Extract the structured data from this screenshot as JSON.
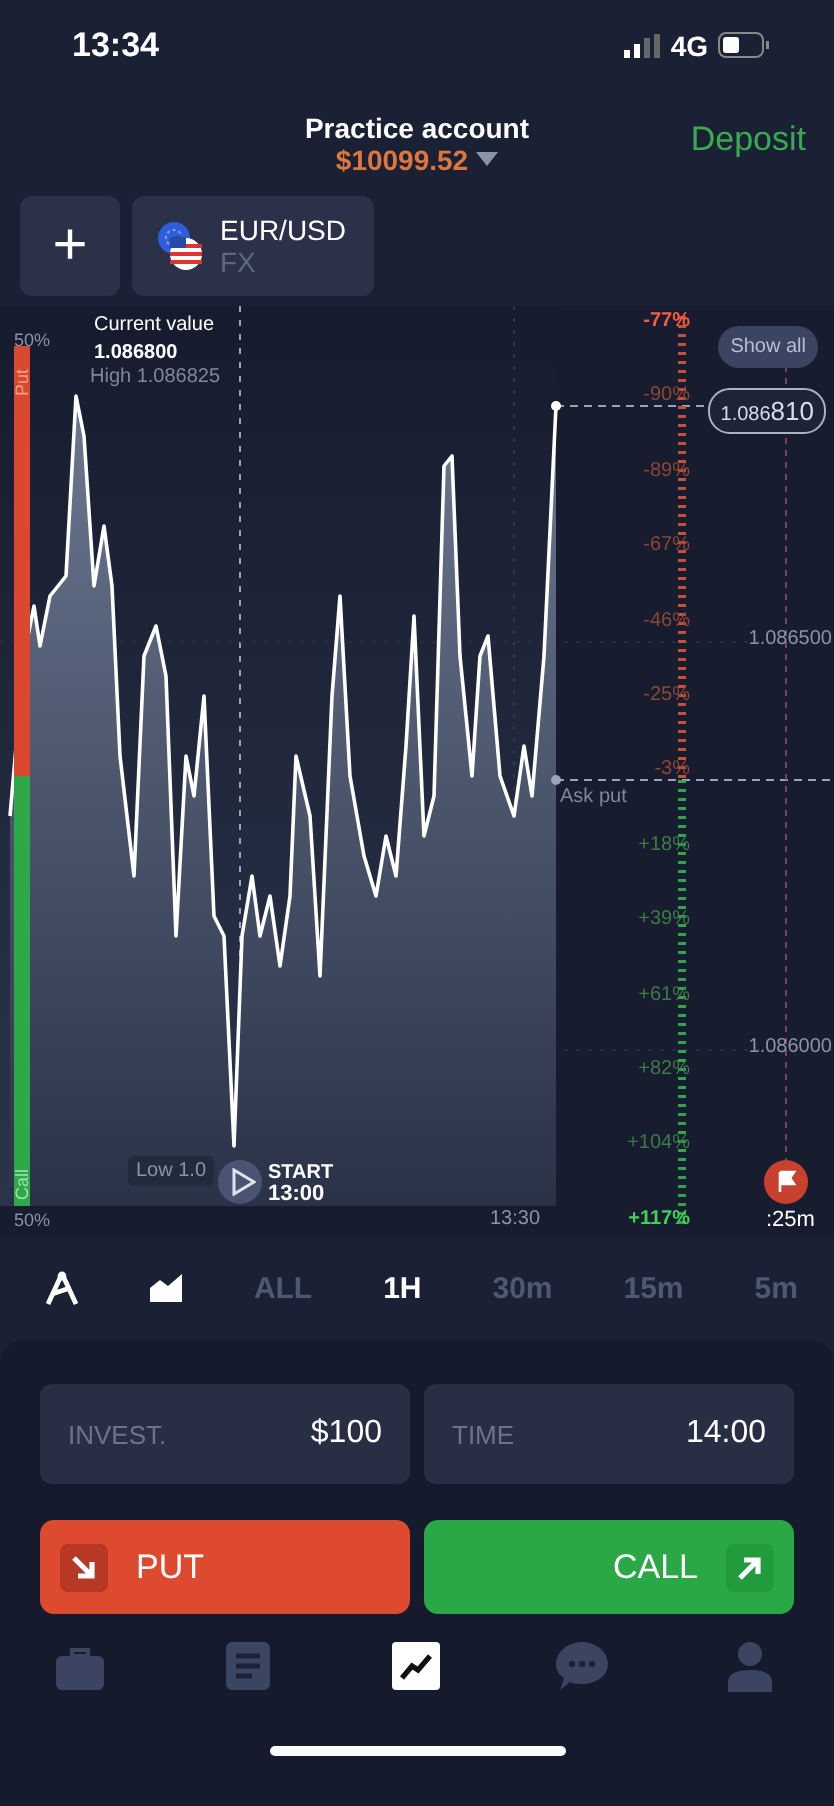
{
  "status_bar": {
    "time": "13:34",
    "network": "4G"
  },
  "header": {
    "account": "Practice account",
    "balance": "$10099.52",
    "deposit": "Deposit"
  },
  "asset": {
    "add": "+",
    "name": "EUR/USD",
    "type": "FX"
  },
  "chart": {
    "current_label": "Current value",
    "current_value": "1.086800",
    "high": "High 1.086825",
    "low": "Low 1.0",
    "show_all": "Show all",
    "price_badge_main": "1.086",
    "price_badge_tail": "810",
    "ask_label": "Ask put",
    "start_label": "START",
    "start_time": "13:00",
    "expiry": ":25m",
    "sentiment": {
      "top_percent": "50%",
      "bottom_percent": "50%",
      "put_label": "Put",
      "call_label": "Call",
      "level": 0.5
    },
    "time_label": "13:30",
    "ladder": [
      {
        "text": "-77%",
        "color": "#ff5a3c",
        "highlighted": true
      },
      {
        "text": "-90%",
        "color": "#8e4536",
        "highlighted": false
      },
      {
        "text": "-89%",
        "color": "#8e4536",
        "highlighted": false
      },
      {
        "text": "-67%",
        "color": "#8e4536",
        "highlighted": false
      },
      {
        "text": "-46%",
        "color": "#8e4536",
        "highlighted": false
      },
      {
        "text": "-25%",
        "color": "#8e4536",
        "highlighted": false
      },
      {
        "text": "-3%",
        "color": "#8e4536",
        "highlighted": false
      },
      {
        "text": "+18%",
        "color": "#3b7b46",
        "highlighted": false
      },
      {
        "text": "+39%",
        "color": "#3b7b46",
        "highlighted": false
      },
      {
        "text": "+61%",
        "color": "#3b7b46",
        "highlighted": false
      },
      {
        "text": "+82%",
        "color": "#3b7b46",
        "highlighted": false
      },
      {
        "text": "+104%",
        "color": "#3b7b46",
        "highlighted": false
      },
      {
        "text": "+117%",
        "color": "#3fd35c",
        "highlighted": true
      }
    ],
    "price_labels": [
      "1.086500",
      "1.086000"
    ]
  },
  "timeframes": [
    {
      "label": "ALL",
      "selected": false
    },
    {
      "label": "1H",
      "selected": true
    },
    {
      "label": "30m",
      "selected": false
    },
    {
      "label": "15m",
      "selected": false
    },
    {
      "label": "5m",
      "selected": false
    }
  ],
  "trade": {
    "invest_label": "INVEST.",
    "invest_value": "$100",
    "time_label": "TIME",
    "time_value": "14:00",
    "put": "PUT",
    "call": "CALL"
  },
  "nav": [
    {
      "kind": "portfolio",
      "selected": false
    },
    {
      "kind": "history",
      "selected": false
    },
    {
      "kind": "chart",
      "selected": true
    },
    {
      "kind": "chat",
      "selected": false
    },
    {
      "kind": "profile",
      "selected": false
    }
  ]
}
